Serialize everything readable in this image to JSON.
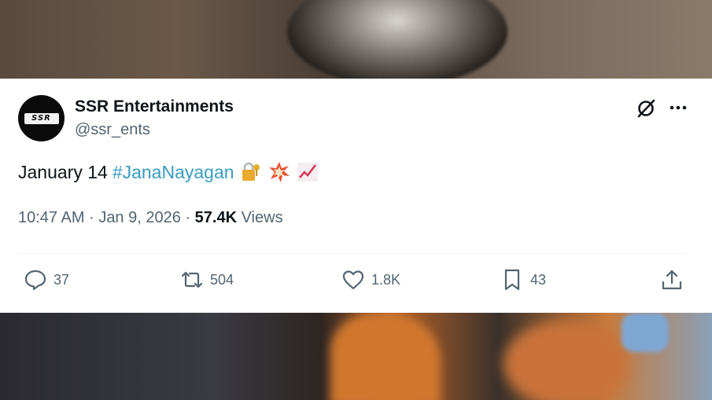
{
  "tweet": {
    "author_name": "SSR Entertainments",
    "author_handle": "@ssr_ents",
    "avatar_text": "SSR",
    "text_prefix": "January 14",
    "hashtag": "#JanaNayagan",
    "emojis": [
      "lock-with-key",
      "collision",
      "chart-increasing"
    ],
    "time": "10:47 AM",
    "separator1": "·",
    "date": "Jan 9, 2026",
    "separator2": "·",
    "views_count": "57.4K",
    "views_label": "Views"
  },
  "actions": {
    "replies": "37",
    "reposts": "504",
    "likes": "1.8K",
    "bookmarks": "43"
  },
  "icons": {
    "grok": "grok-icon",
    "more": "more-icon",
    "reply": "reply-icon",
    "repost": "repost-icon",
    "like": "heart-icon",
    "bookmark": "bookmark-icon",
    "share": "share-icon"
  },
  "colors": {
    "text": "#0f1419",
    "secondary": "#536471",
    "hashtag": "#3a9bbf",
    "card": "#ffffff"
  }
}
